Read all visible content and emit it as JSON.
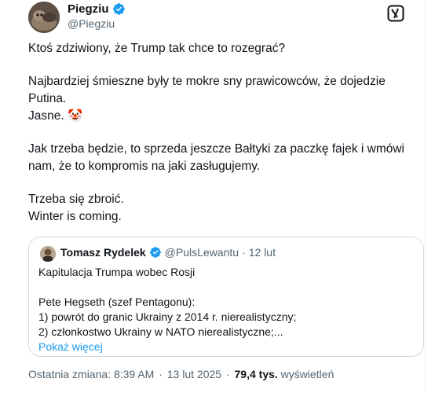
{
  "author": {
    "display_name": "Piegziu",
    "handle": "@Piegziu"
  },
  "tweet_lines": [
    "Ktoś zdziwiony, że Trump tak chce to rozegrać?",
    "Najbardziej śmieszne były te mokre sny prawicowców, że dojedzie Putina.",
    "Jasne. 🤡",
    "Jak trzeba będzie, to sprzeda jeszcze Bałtyki za paczkę fajek i wmówi nam, że to kompromis na jaki zasługujemy.",
    "Trzeba się zbroić.",
    "Winter is coming."
  ],
  "quoted": {
    "display_name": "Tomasz Rydelek",
    "handle": "@PulsLewantu",
    "separator": "·",
    "date": "12 lut",
    "title": "Kapitulacja Trumpa wobec Rosji",
    "lines": [
      "Pete Hegseth (szef Pentagonu):",
      "1) powrót do granic Ukrainy z 2014 r. nierealistyczny;",
      "2) członkostwo Ukrainy w NATO nierealistyczne;..."
    ],
    "show_more": "Pokaż więcej"
  },
  "meta": {
    "edited_label": "Ostatnia zmiana: 8:39 AM",
    "separator": "·",
    "date": "13 lut 2025",
    "views_count": "79,4 tys.",
    "views_label": "wyświetleń"
  },
  "colors": {
    "verified": "#1d9bf0",
    "link": "#1d9bf0",
    "muted": "#536471",
    "text": "#0f1419",
    "border": "#cfd9de"
  },
  "icons": {
    "verified": "verified-badge-icon",
    "grok": "grok-icon",
    "more": "more-dots-icon"
  }
}
